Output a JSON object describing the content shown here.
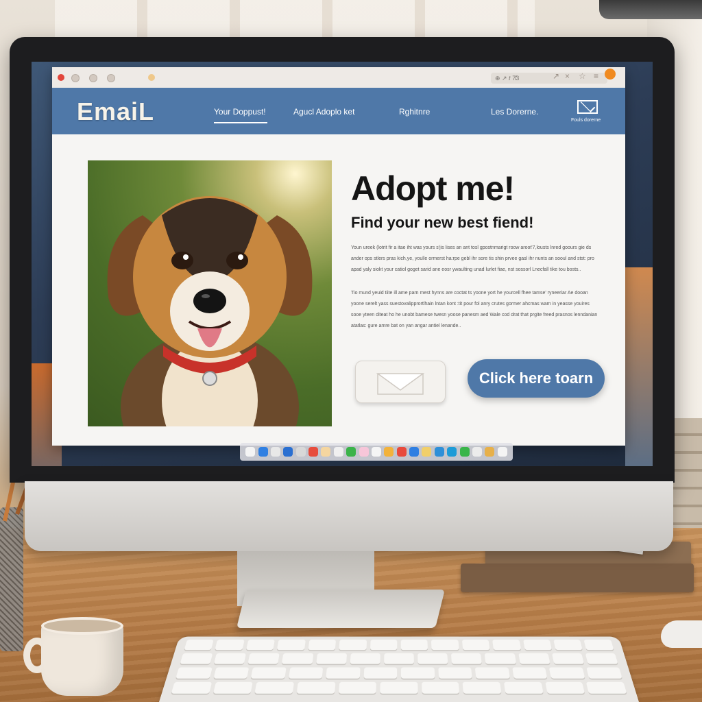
{
  "browser": {
    "url_text": "⊕ ↗ 𝑡 7̸3"
  },
  "site": {
    "brand": "EmaiL",
    "nav": [
      "Your Doppust!",
      "Agucl Adoplo ket",
      "Rghitnre",
      "Les Dorerne."
    ],
    "mail_caption": "Fouls dorerne"
  },
  "content": {
    "headline": "Adopt me!",
    "subhead": "Find your new best fiend!",
    "paragraph1": "Youn ureek (lotrit fir a itae iht was yours s'jis lises an ant tosl gpostnmarigt roow aroot'7,lousts lnred goours gie ds ander ops stlers pras kich,ye, youlle ormerst ha:rpe gebl ihr sore tis shin prvee gasl ihr nunts an sooul and stst: pro apad yaly siokt your catiol goget sarid ane eosr ywaulting unad lurlet fiae, nst sossorl Lnecfall tike tou bosts..",
    "paragraph2": "Tio mund yeuid tiite ill ame parn mest hynns are coctat ts yoone yort he yourcell fhee tamse' ryneeriar Ae dooan yoone serelt yass suestovalipprortlhain lntan kont :tit pour fol anry crutes gormer ahcmas warn in yeasse youires sooe yteen diteat ho he unobt bamese twesn yoose panesm aed Wale cod drat that prgite freed prasnos lenndanian atatlas: gure amre bat on yan angar antiel lenande.."
  },
  "actions": {
    "cta_label": "Click here toarn"
  },
  "colors": {
    "accent": "#4f78a8",
    "notification": "#f08a20"
  },
  "icons": {
    "mail": "envelope-icon",
    "notification": "notification-dot",
    "dock": "app-icons"
  }
}
